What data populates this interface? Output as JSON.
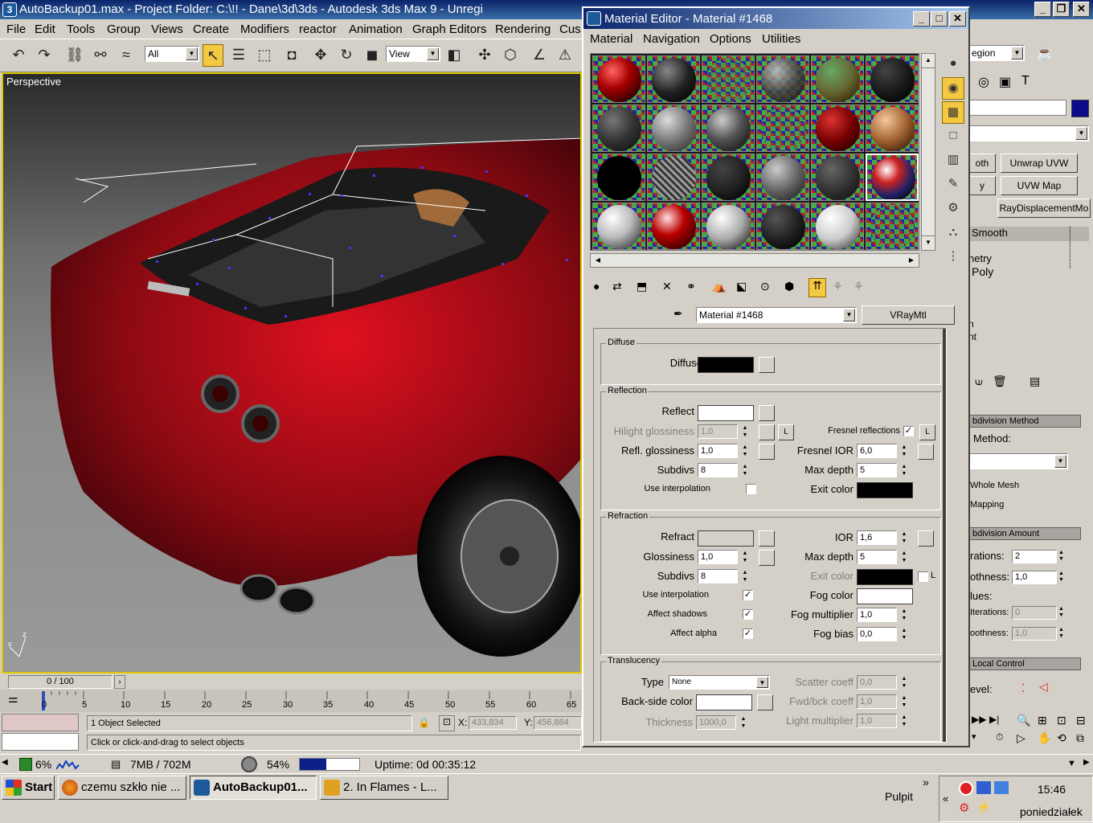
{
  "main_window": {
    "title": "AutoBackup01.max    - Project Folder: C:\\!! - Dane\\3d\\3ds    - Autodesk 3ds Max 9  - Unregi",
    "logo": "3",
    "minimize": "_",
    "maximize": "❐",
    "close": "✕"
  },
  "menu": [
    "File",
    "Edit",
    "Tools",
    "Group",
    "Views",
    "Create",
    "Modifiers",
    "reactor",
    "Animation",
    "Graph Editors",
    "Rendering",
    "Cus"
  ],
  "toolbar": {
    "selection_filter": "All",
    "reference_coord": "View",
    "right_combo": "egion"
  },
  "viewport": {
    "label": "Perspective",
    "axis_z": "z",
    "axis_x": "x"
  },
  "timeline": {
    "frame": "0 / 100",
    "ticks": [
      "0",
      "5",
      "10",
      "15",
      "20",
      "25",
      "30",
      "35",
      "40",
      "45",
      "50",
      "55",
      "60",
      "65"
    ]
  },
  "status": {
    "selection": "1 Object Selected",
    "prompt": "Click or click-and-drag to select objects",
    "x_label": "X:",
    "x_value": "433,834",
    "y_label": "Y:",
    "y_value": "456,884"
  },
  "sysbar": {
    "cpu": "6%",
    "mem": "7MB / 702M",
    "disk": "54%",
    "uptime": "Uptime: 0d 00:35:12"
  },
  "taskbar": {
    "start": "Start",
    "tasks": [
      "czemu szkło nie ...",
      "AutoBackup01...",
      "2. In Flames - L..."
    ],
    "pulpit": "Pulpit",
    "time": "15:46",
    "day": "poniedziałek"
  },
  "command_panel": {
    "buttons": [
      "oth",
      "Unwrap UVW",
      "y",
      "UVW Map",
      "RayDisplacementMo"
    ],
    "stack": [
      "Smooth",
      "netry",
      "Poly",
      "n",
      "nt"
    ],
    "rollouts": [
      "bdivision Method",
      "bdivision Amount",
      "Local Control"
    ],
    "labels": {
      "method": "Method:",
      "whole_mesh": "Whole Mesh",
      "mapping": "Mapping",
      "iterations": "rations:",
      "iterations_val": "2",
      "smoothness": "othness:",
      "smoothness_val": "1,0",
      "values": "lues:",
      "render_iter": "Iterations:",
      "render_iter_val": "0",
      "render_smooth": "oothness:",
      "render_smooth_val": "1,0",
      "level": "evel:"
    },
    "color_swatch": "#0a0a8a"
  },
  "material_editor": {
    "title": "Material Editor - Material #1468",
    "menu": [
      "Material",
      "Navigation",
      "Options",
      "Utilities"
    ],
    "material_name": "Material #1468",
    "material_type": "VRayMtl",
    "diffuse": {
      "group": "Diffuse",
      "label": "Diffuse",
      "color": "#000000"
    },
    "reflection": {
      "group": "Reflection",
      "reflect": "Reflect",
      "reflect_color": "#ffffff",
      "hilight": "Hilight glossiness",
      "hilight_val": "1,0",
      "lock": "L",
      "refl_gloss": "Refl. glossiness",
      "refl_gloss_val": "1,0",
      "subdivs": "Subdivs",
      "subdivs_val": "8",
      "use_interp": "Use interpolation",
      "fresnel": "Fresnel reflections",
      "fresnel_checked": "✓",
      "fresnel_ior": "Fresnel IOR",
      "fresnel_ior_val": "6,0",
      "max_depth": "Max depth",
      "max_depth_val": "5",
      "exit_color": "Exit color",
      "exit_color_val": "#000000"
    },
    "refraction": {
      "group": "Refraction",
      "refract": "Refract",
      "refract_color": "#d4d0c8",
      "glossiness": "Glossiness",
      "glossiness_val": "1,0",
      "subdivs": "Subdivs",
      "subdivs_val": "8",
      "use_interp": "Use interpolation",
      "use_interp_checked": "✓",
      "affect_shadows": "Affect shadows",
      "affect_shadows_checked": "✓",
      "affect_alpha": "Affect alpha",
      "affect_alpha_checked": "✓",
      "ior": "IOR",
      "ior_val": "1,6",
      "max_depth": "Max depth",
      "max_depth_val": "5",
      "exit_color": "Exit color",
      "exit_color_val": "#000000",
      "exit_lock": "L",
      "fog_color": "Fog color",
      "fog_color_val": "#ffffff",
      "fog_mult": "Fog multiplier",
      "fog_mult_val": "1,0",
      "fog_bias": "Fog bias",
      "fog_bias_val": "0,0"
    },
    "translucency": {
      "group": "Translucency",
      "type": "Type",
      "type_val": "None",
      "backside": "Back-side color",
      "backside_color": "#ffffff",
      "thickness": "Thickness",
      "thickness_val": "1000,0",
      "scatter": "Scatter coeff",
      "scatter_val": "0,0",
      "fwdbck": "Fwd/bck coeff",
      "fwdbck_val": "1,0",
      "light_mult": "Light multiplier",
      "light_mult_val": "1,0"
    }
  }
}
